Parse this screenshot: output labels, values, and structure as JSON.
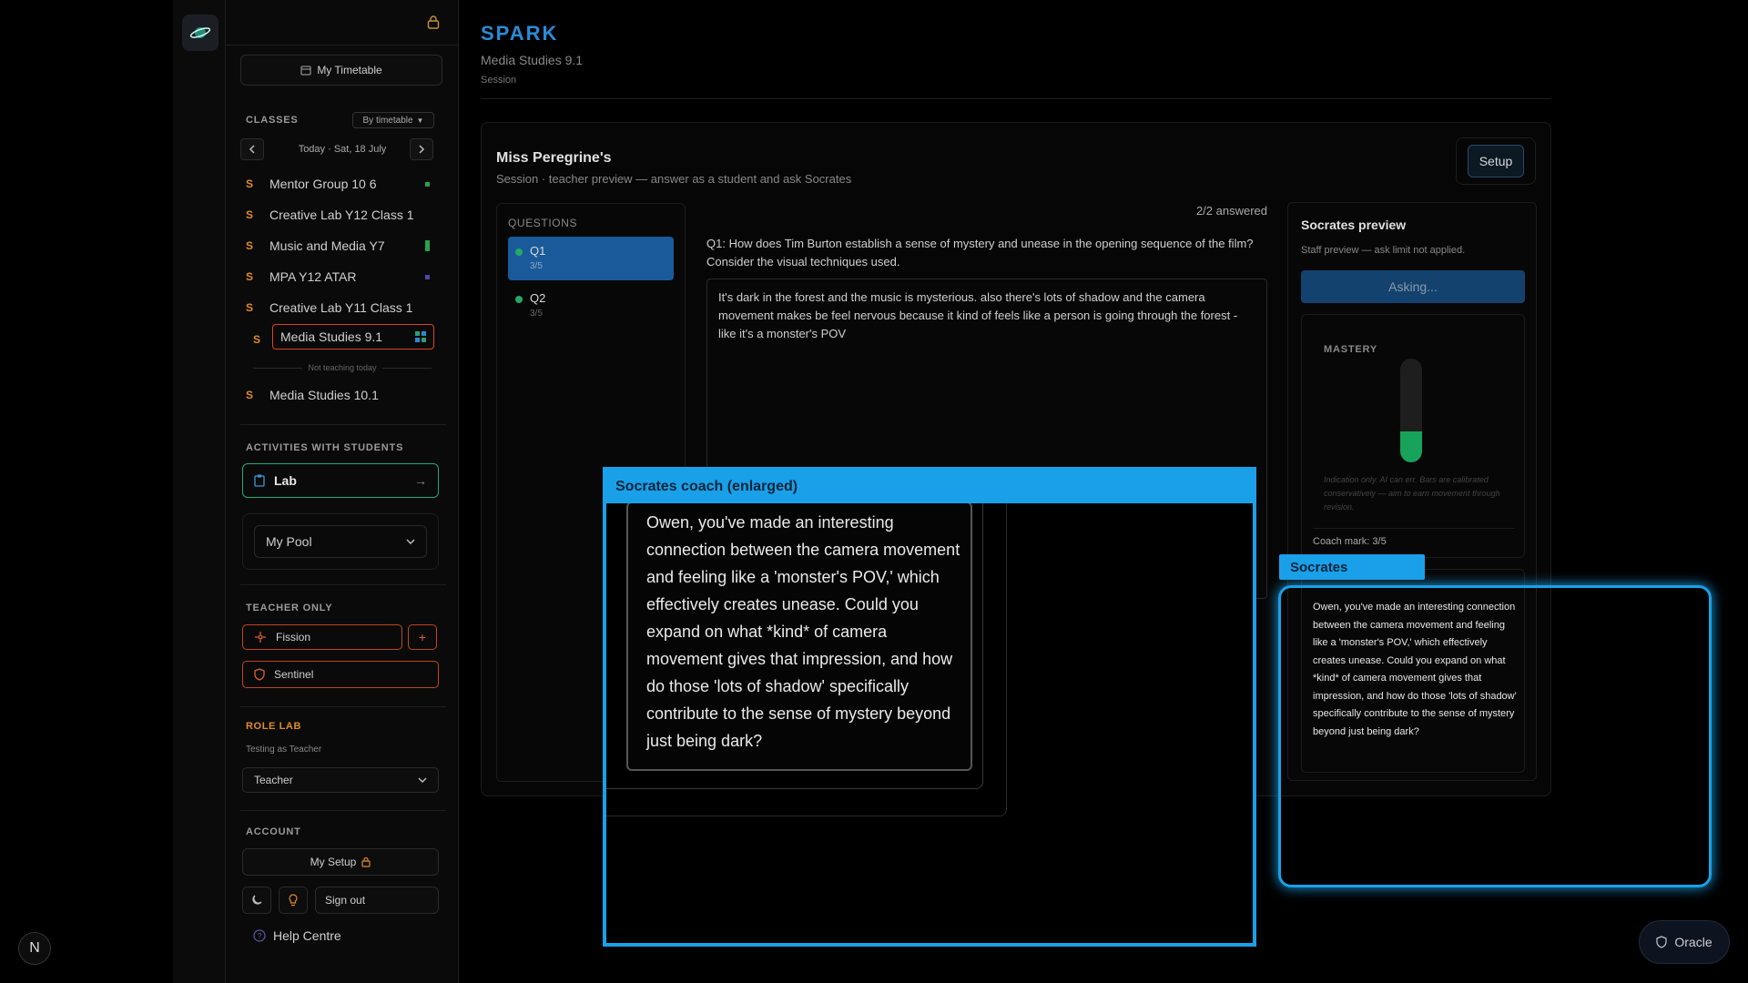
{
  "app": {
    "title": "SPARK",
    "class_name": "Media Studies 9.1",
    "page_label": "Session"
  },
  "sidebar": {
    "timetable_label": "My Timetable",
    "classes_title": "CLASSES",
    "sort_select": "By timetable",
    "date_label": "Today · Sat, 18 July",
    "classes": [
      {
        "prefix": "S",
        "name": "Mentor Group 10 6",
        "color": "#2aa04a"
      },
      {
        "prefix": "S",
        "name": "Creative Lab Y12 Class 1",
        "color": ""
      },
      {
        "prefix": "S",
        "name": "Music and Media Y7",
        "color": "#2aa04a"
      },
      {
        "prefix": "S",
        "name": "MPA Y12 ATAR",
        "color": "#4a4aa8"
      },
      {
        "prefix": "S",
        "name": "Creative Lab Y11 Class 1",
        "color": ""
      },
      {
        "prefix": "S",
        "name": "Media Studies 9.1",
        "color": "#2aa070"
      }
    ],
    "not_teaching_label": "Not teaching today",
    "other_classes": [
      {
        "prefix": "S",
        "name": "Media Studies 10.1"
      }
    ],
    "activities_title": "ACTIVITIES WITH STUDENTS",
    "lab_label": "Lab",
    "pool_label": "My Pool",
    "teacher_only_title": "TEACHER ONLY",
    "fission_label": "Fission",
    "sentinel_label": "Sentinel",
    "role_lab_title": "ROLE LAB",
    "role_lab_sub": "Testing as Teacher",
    "role_select": "Teacher",
    "account_title": "ACCOUNT",
    "my_setup_label": "My Setup",
    "sign_out_label": "Sign out",
    "help_label": "Help Centre"
  },
  "card": {
    "title": "Miss Peregrine's",
    "subtitle": "Session · teacher preview — answer as a student and ask Socrates",
    "setup_label": "Setup"
  },
  "questions": {
    "label": "QUESTIONS",
    "items": [
      {
        "name": "Q1",
        "score": "3/5"
      },
      {
        "name": "Q2",
        "score": "3/5"
      }
    ],
    "answered": "2/2 answered",
    "current_text": "Q1: How does Tim Burton establish a sense of mystery and unease in the opening sequence of the film? Consider the visual techniques used.",
    "answer": "It's dark in the forest and the music is mysterious.  also there's lots of shadow and the camera movement makes be feel nervous because it kind of feels like a person is going through the forest - like it's a monster's POV"
  },
  "socrates": {
    "title": "Socrates preview",
    "note": "Staff preview — ask limit not applied.",
    "asking_label": "Asking...",
    "mastery_title": "MASTERY",
    "mastery_level": 0.3,
    "mastery_note": "Indication only. AI can err. Bars are calibrated conservatively — aim to earn movement through revision.",
    "coach_mark": "Coach mark: 3/5",
    "tag_label": "Socrates",
    "reply": "Owen, you've made an interesting connection between the camera movement and feeling like a 'monster's POV,' which effectively creates unease. Could you expand on what *kind* of camera movement gives that impression, and how do those 'lots of shadow' specifically contribute to the sense of mystery beyond just being dark?"
  },
  "overlay": {
    "title": "Socrates coach (enlarged)",
    "text": "Owen, you've made an interesting connection between the camera movement and feeling like a 'monster's POV,' which effectively creates unease. Could you expand on what *kind* of camera movement gives that impression, and how do those 'lots of shadow' specifically contribute to the sense of mystery beyond just being dark?"
  },
  "oracle_label": "Oracle",
  "corner_badge": "N"
}
